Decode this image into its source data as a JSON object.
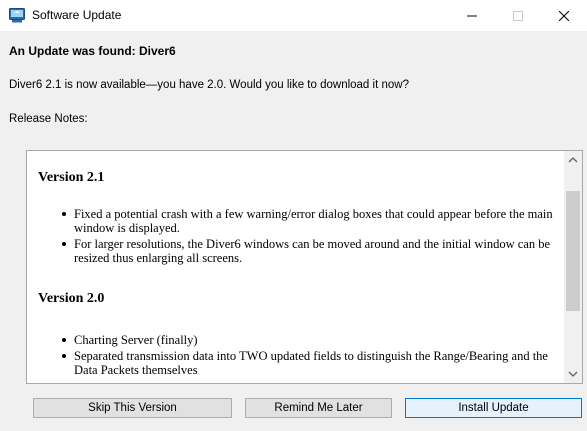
{
  "window": {
    "title": "Software Update",
    "controls": {
      "minimize": "—",
      "maximize": "☐",
      "close": "✕"
    }
  },
  "dialog": {
    "heading": "An Update was found: Diver6",
    "message": "Diver6 2.1 is now available—you have 2.0. Would you like to download it now?",
    "release_notes_label": "Release Notes:"
  },
  "release_notes": {
    "versions": [
      {
        "heading": "Version 2.1",
        "items": [
          "Fixed a potential crash with a few warning/error dialog boxes that could appear before the main window is displayed.",
          "For larger resolutions, the Diver6 windows can be moved around and the initial window can be resized thus enlarging all screens."
        ]
      },
      {
        "heading": "Version 2.0",
        "items": [
          "Charting Server (finally)",
          "Separated transmission data into TWO updated fields to distinguish the Range/Bearing and the Data Packets themselves"
        ]
      }
    ]
  },
  "buttons": {
    "skip": "Skip This Version",
    "remind": "Remind Me Later",
    "install": "Install Update"
  },
  "colors": {
    "window_bg": "#f0f0f0",
    "title_bg": "#ffffff",
    "focus_border": "#0078d7",
    "button_bg": "#e1e1e1",
    "scroll_thumb": "#cdcdcd"
  }
}
